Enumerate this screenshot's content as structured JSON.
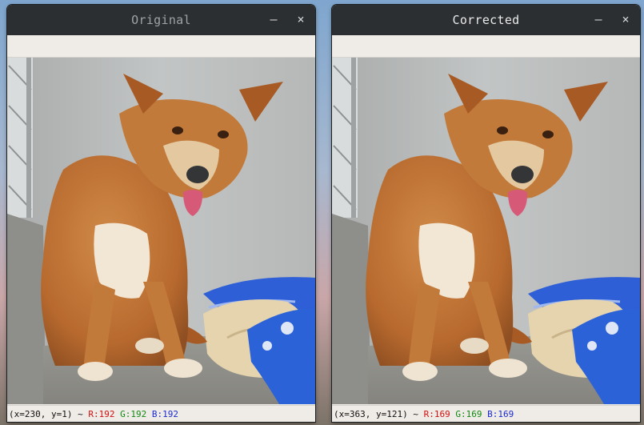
{
  "windows": [
    {
      "title": "Original",
      "minimize_label": "–",
      "close_label": "×",
      "status": {
        "coords": "(x=230, y=1) ~ ",
        "r": "R:192",
        "g": "G:192",
        "b": "B:192"
      }
    },
    {
      "title": "Corrected",
      "minimize_label": "–",
      "close_label": "×",
      "status": {
        "coords": "(x=363, y=121) ~ ",
        "r": "R:169",
        "g": "G:169",
        "b": "B:169"
      }
    }
  ],
  "colors": {
    "titlebar": "#2b2f31",
    "status_red": "#d01010",
    "status_green": "#118811",
    "status_blue": "#1a2ad0"
  }
}
